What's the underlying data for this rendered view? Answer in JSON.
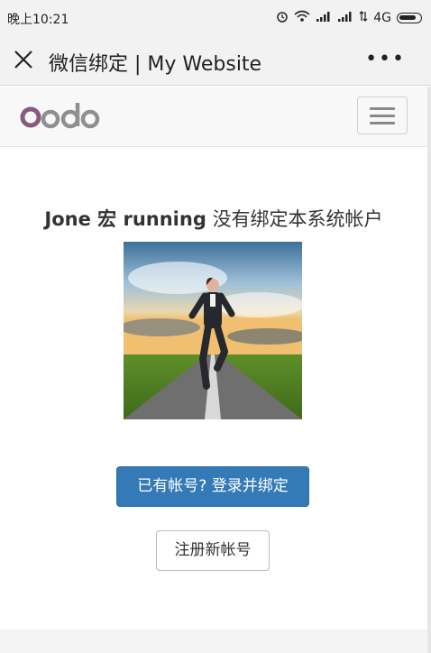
{
  "status_bar": {
    "time": "晚上10:21",
    "network": "4G"
  },
  "nav_bar": {
    "title": "微信绑定 | My Website",
    "more": "•••"
  },
  "site": {
    "logo_text": "odoo",
    "brand_color": "#875A7B"
  },
  "main": {
    "user_name": "Jone 宏 running",
    "message_suffix": "没有绑定本系统帐户",
    "avatar_alt": "running man photo",
    "bind_button": "已有帐号? 登录并绑定",
    "register_button": "注册新帐号"
  },
  "colors": {
    "primary": "#337ab7",
    "header_bg": "#f8f8f8"
  }
}
